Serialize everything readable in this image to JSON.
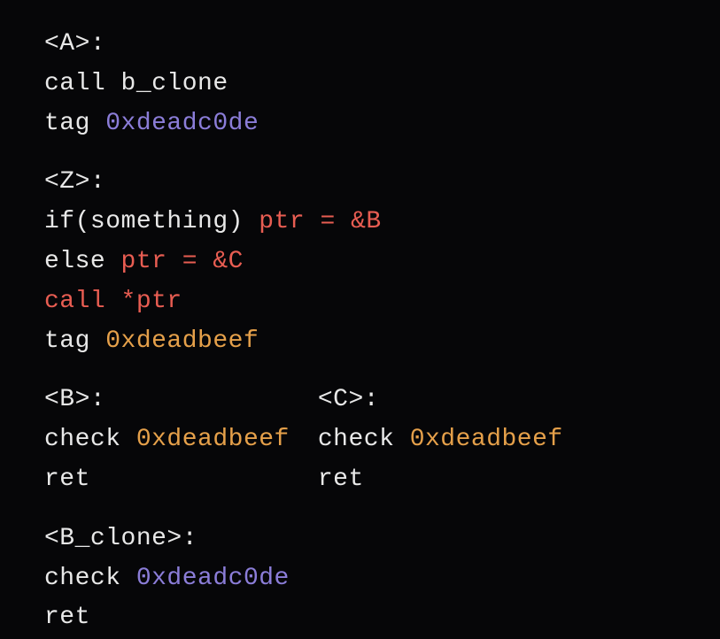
{
  "a": {
    "label": "<A>:",
    "call_kw": "call ",
    "call_tgt": "b_clone",
    "tag_kw": "tag ",
    "tag_val": "0xdeadc0de"
  },
  "z": {
    "label": "<Z>:",
    "if_head": "if(something) ",
    "if_body": "ptr = &B",
    "else_kw": "else ",
    "else_body": "ptr = &C",
    "call_line": "call *ptr",
    "tag_kw": "tag ",
    "tag_val": "0xdeadbeef"
  },
  "b": {
    "label": "<B>:",
    "check_kw": "check ",
    "check_val": "0xdeadbeef",
    "ret": "ret"
  },
  "c": {
    "label": "<C>:",
    "check_kw": "check ",
    "check_val": "0xdeadbeef",
    "ret": "ret"
  },
  "bclone": {
    "label": "<B_clone>:",
    "check_kw": "check ",
    "check_val": "0xdeadc0de",
    "ret": "ret"
  }
}
